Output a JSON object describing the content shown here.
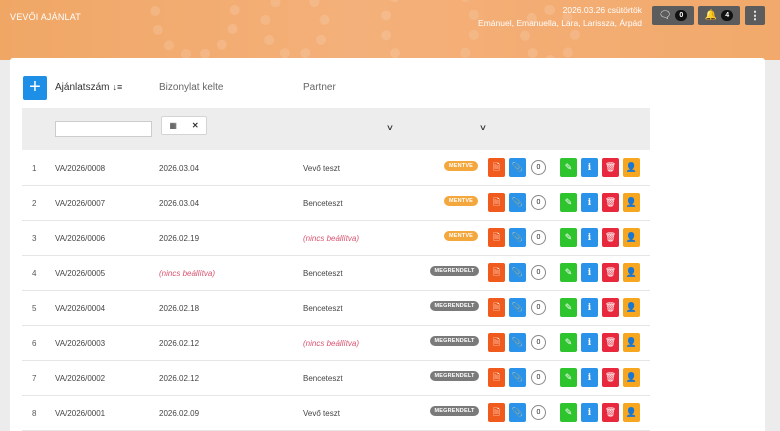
{
  "header": {
    "app_title": "VEVŐI AJÁNLAT",
    "date_line": "2026.03.26 csütörtök",
    "users_line": "Emánuel, Emanuella, Lara, Larissza, Árpád",
    "messages_count": "0",
    "notifications_count": "4",
    "icons": {
      "messages": "chat-bubble-icon",
      "notifications": "bell-icon",
      "menu": "kebab-menu-icon"
    }
  },
  "table": {
    "headers": {
      "offer_number": "Ajánlatszám",
      "doc_date": "Bizonylat kelte",
      "partner": "Partner"
    },
    "add_label": "+",
    "rows": [
      {
        "num": "1",
        "code": "VA/2026/0008",
        "date": "2026.03.04",
        "partner": "Vevő teszt",
        "status": "MENTVE",
        "count": "0"
      },
      {
        "num": "2",
        "code": "VA/2026/0007",
        "date": "2026.03.04",
        "partner": "Benceteszt",
        "status": "MENTVE",
        "count": "0"
      },
      {
        "num": "3",
        "code": "VA/2026/0006",
        "date": "2026.02.19",
        "partner": "(nincs beállítva)",
        "status": "MENTVE",
        "count": "0"
      },
      {
        "num": "4",
        "code": "VA/2026/0005",
        "date": "(nincs beállítva)",
        "partner": "Benceteszt",
        "status": "MEGRENDELT",
        "count": "0"
      },
      {
        "num": "5",
        "code": "VA/2026/0004",
        "date": "2026.02.18",
        "partner": "Benceteszt",
        "status": "MEGRENDELT",
        "count": "0"
      },
      {
        "num": "6",
        "code": "VA/2026/0003",
        "date": "2026.02.12",
        "partner": "(nincs beállítva)",
        "status": "MEGRENDELT",
        "count": "0"
      },
      {
        "num": "7",
        "code": "VA/2026/0002",
        "date": "2026.02.12",
        "partner": "Benceteszt",
        "status": "MEGRENDELT",
        "count": "0"
      },
      {
        "num": "8",
        "code": "VA/2026/0001",
        "date": "2026.02.09",
        "partner": "Vevő teszt",
        "status": "MEGRENDELT",
        "count": "0"
      }
    ]
  },
  "colors": {
    "header_bg": "#f2a96b",
    "primary": "#1e8fe6",
    "saved": "#f3a73c",
    "ordered": "#7a7a7a",
    "pdf": "#f05a1d",
    "attach": "#2a92e8",
    "edit": "#2ec42e",
    "delete": "#e8283c",
    "user": "#f6a71f"
  }
}
